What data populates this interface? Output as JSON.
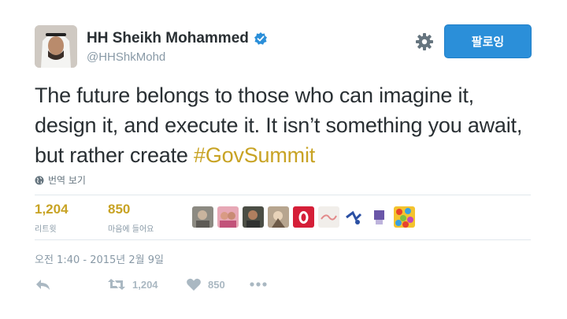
{
  "header": {
    "name": "HH Sheikh Mohammed",
    "handle": "@HHShkMohd",
    "follow_label": "팔로잉"
  },
  "tweet": {
    "text": "The future belongs to those who can imagine it, design it, and execute it. It isn’t something you await, but rather create ",
    "hashtag": "#GovSummit",
    "translate_label": "번역 보기"
  },
  "stats": {
    "retweets": "1,204",
    "retweets_label": "리트윗",
    "likes": "850",
    "likes_label": "마음에 들어요"
  },
  "timestamp": "오전 1:40 - 2015년 2월 9일",
  "actions": {
    "retweet_count": "1,204",
    "like_count": "850"
  },
  "colors": {
    "accent": "#c8a324",
    "follow_button": "#2b8fd9",
    "verified": "#2b8fd9",
    "muted": "#8899a6"
  }
}
